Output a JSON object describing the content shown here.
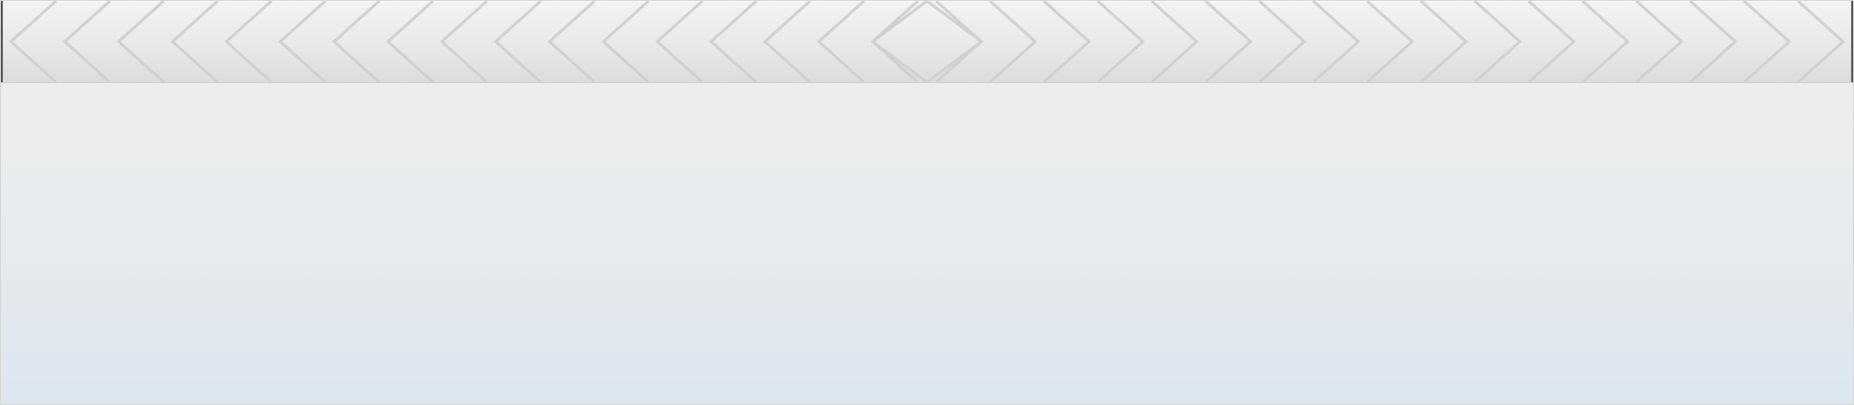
{
  "colors": {
    "band_top": "#f3f3f3",
    "band_bottom": "#dcdcdc",
    "chevron_stroke": "#d0d0d0",
    "panel_top": "#eeeeee",
    "panel_bottom": "#dfe7f0",
    "frame_border": "#d4d6d8"
  },
  "header": {
    "pattern": "chevron-band"
  }
}
